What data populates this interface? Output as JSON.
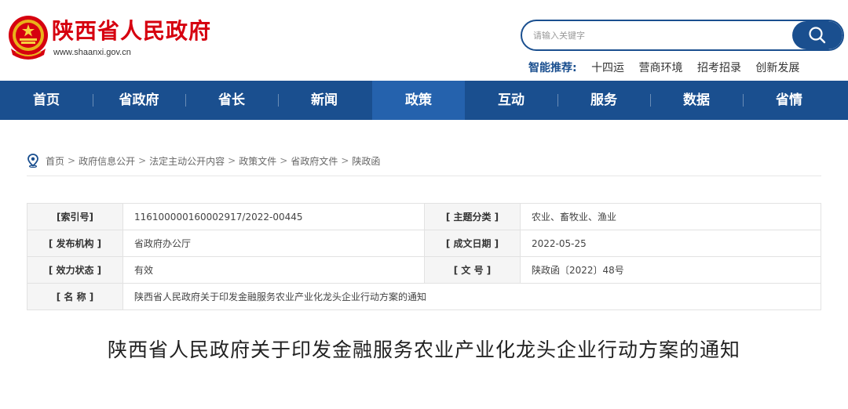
{
  "header": {
    "site_name": "陕西省人民政府",
    "site_url": "www.shaanxi.gov.cn",
    "logo_icon": "national-emblem-icon"
  },
  "search": {
    "placeholder": "请输入关键字",
    "button_icon": "search-icon"
  },
  "recommend": {
    "label": "智能推荐:",
    "items": [
      "十四运",
      "营商环境",
      "招考招录",
      "创新发展"
    ]
  },
  "nav": {
    "items": [
      "首页",
      "省政府",
      "省长",
      "新闻",
      "政策",
      "互动",
      "服务",
      "数据",
      "省情"
    ],
    "active": "政策"
  },
  "breadcrumb": {
    "icon": "location-pin-icon",
    "items": [
      "首页",
      "政府信息公开",
      "法定主动公开内容",
      "政策文件",
      "省政府文件",
      "陕政函"
    ],
    "separator": ">"
  },
  "info": {
    "index_label": "[索引号]",
    "index_value": "116100000160002917/2022-00445",
    "topic_label": "[ 主题分类 ]",
    "topic_value": "农业、畜牧业、渔业",
    "publisher_label": "[ 发布机构 ]",
    "publisher_value": "省政府办公厅",
    "date_label": "[ 成文日期 ]",
    "date_value": "2022-05-25",
    "status_label": "[ 效力状态 ]",
    "status_value": "有效",
    "docno_label": "[ 文 号 ]",
    "docno_value": "陕政函〔2022〕48号",
    "name_label": "[ 名 称 ]",
    "name_value": "陕西省人民政府关于印发金融服务农业产业化龙头企业行动方案的通知"
  },
  "document": {
    "title": "陕西省人民政府关于印发金融服务农业产业化龙头企业行动方案的通知"
  },
  "colors": {
    "brand_red": "#d6000f",
    "nav_blue": "#1a4f8f",
    "nav_active": "#2562ad"
  }
}
